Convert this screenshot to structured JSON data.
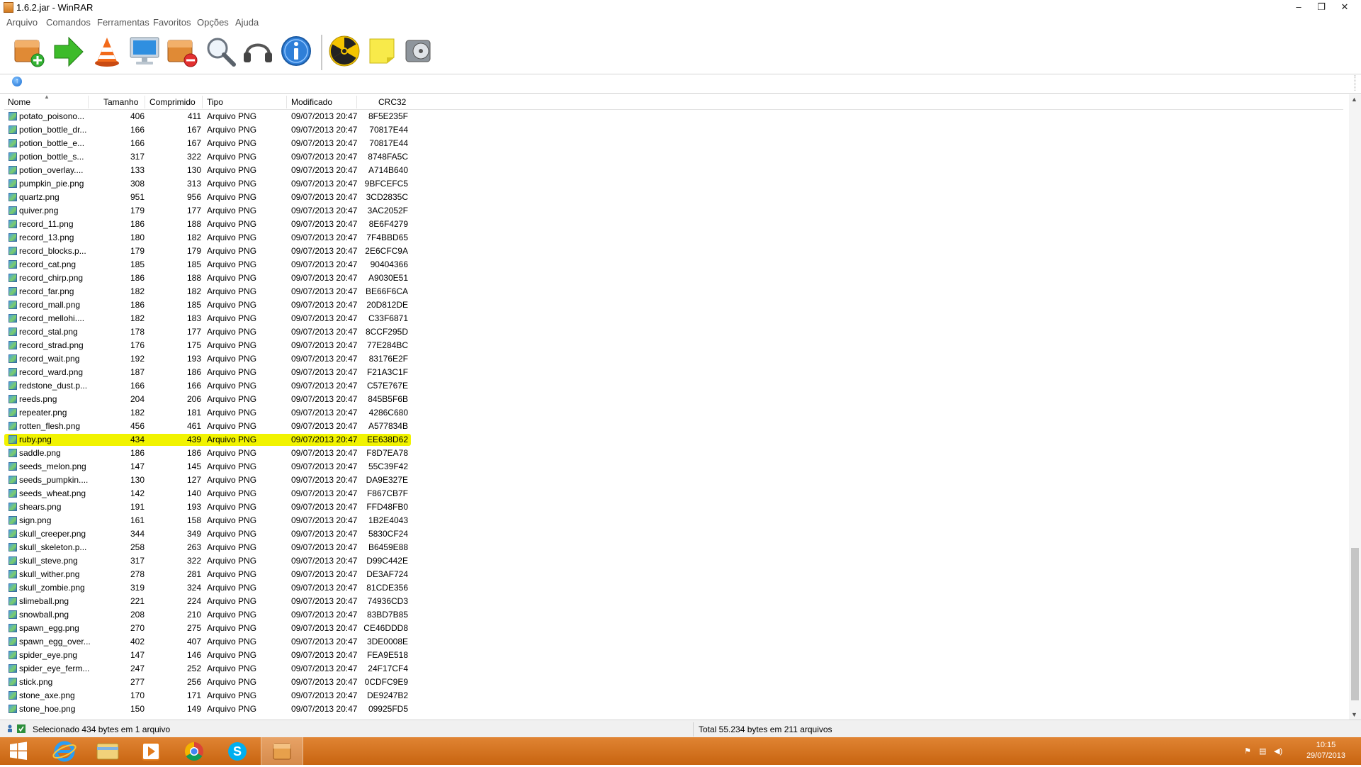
{
  "window": {
    "title": "1.6.2.jar - WinRAR",
    "controls": {
      "minimize": "–",
      "restore": "❐",
      "close": "✕"
    }
  },
  "menu": [
    "Arquivo",
    "Comandos",
    "Ferramentas",
    "Favoritos",
    "Opções",
    "Ajuda"
  ],
  "toolbar": {
    "buttons": [
      "add-icon",
      "extract-icon",
      "test-icon",
      "view-icon",
      "delete-icon",
      "find-icon",
      "wizard-icon",
      "info-icon",
      "virus-scan-icon",
      "comment-icon",
      "sfx-icon"
    ]
  },
  "columns": {
    "name": "Nome",
    "size": "Tamanho",
    "packed": "Comprimido",
    "type": "Tipo",
    "modified": "Modificado",
    "crc": "CRC32"
  },
  "files": [
    {
      "name": "potato_poisono...",
      "size": "406",
      "packed": "411",
      "type": "Arquivo PNG",
      "modified": "09/07/2013 20:47",
      "crc": "8F5E235F"
    },
    {
      "name": "potion_bottle_dr...",
      "size": "166",
      "packed": "167",
      "type": "Arquivo PNG",
      "modified": "09/07/2013 20:47",
      "crc": "70817E44"
    },
    {
      "name": "potion_bottle_e...",
      "size": "166",
      "packed": "167",
      "type": "Arquivo PNG",
      "modified": "09/07/2013 20:47",
      "crc": "70817E44"
    },
    {
      "name": "potion_bottle_s...",
      "size": "317",
      "packed": "322",
      "type": "Arquivo PNG",
      "modified": "09/07/2013 20:47",
      "crc": "8748FA5C"
    },
    {
      "name": "potion_overlay....",
      "size": "133",
      "packed": "130",
      "type": "Arquivo PNG",
      "modified": "09/07/2013 20:47",
      "crc": "A714B640"
    },
    {
      "name": "pumpkin_pie.png",
      "size": "308",
      "packed": "313",
      "type": "Arquivo PNG",
      "modified": "09/07/2013 20:47",
      "crc": "9BFCEFC5"
    },
    {
      "name": "quartz.png",
      "size": "951",
      "packed": "956",
      "type": "Arquivo PNG",
      "modified": "09/07/2013 20:47",
      "crc": "3CD2835C"
    },
    {
      "name": "quiver.png",
      "size": "179",
      "packed": "177",
      "type": "Arquivo PNG",
      "modified": "09/07/2013 20:47",
      "crc": "3AC2052F"
    },
    {
      "name": "record_11.png",
      "size": "186",
      "packed": "188",
      "type": "Arquivo PNG",
      "modified": "09/07/2013 20:47",
      "crc": "8E6F4279"
    },
    {
      "name": "record_13.png",
      "size": "180",
      "packed": "182",
      "type": "Arquivo PNG",
      "modified": "09/07/2013 20:47",
      "crc": "7F4BBD65"
    },
    {
      "name": "record_blocks.p...",
      "size": "179",
      "packed": "179",
      "type": "Arquivo PNG",
      "modified": "09/07/2013 20:47",
      "crc": "2E6CFC9A"
    },
    {
      "name": "record_cat.png",
      "size": "185",
      "packed": "185",
      "type": "Arquivo PNG",
      "modified": "09/07/2013 20:47",
      "crc": "90404366"
    },
    {
      "name": "record_chirp.png",
      "size": "186",
      "packed": "188",
      "type": "Arquivo PNG",
      "modified": "09/07/2013 20:47",
      "crc": "A9030E51"
    },
    {
      "name": "record_far.png",
      "size": "182",
      "packed": "182",
      "type": "Arquivo PNG",
      "modified": "09/07/2013 20:47",
      "crc": "BE66F6CA"
    },
    {
      "name": "record_mall.png",
      "size": "186",
      "packed": "185",
      "type": "Arquivo PNG",
      "modified": "09/07/2013 20:47",
      "crc": "20D812DE"
    },
    {
      "name": "record_mellohi....",
      "size": "182",
      "packed": "183",
      "type": "Arquivo PNG",
      "modified": "09/07/2013 20:47",
      "crc": "C33F6871"
    },
    {
      "name": "record_stal.png",
      "size": "178",
      "packed": "177",
      "type": "Arquivo PNG",
      "modified": "09/07/2013 20:47",
      "crc": "8CCF295D"
    },
    {
      "name": "record_strad.png",
      "size": "176",
      "packed": "175",
      "type": "Arquivo PNG",
      "modified": "09/07/2013 20:47",
      "crc": "77E284BC"
    },
    {
      "name": "record_wait.png",
      "size": "192",
      "packed": "193",
      "type": "Arquivo PNG",
      "modified": "09/07/2013 20:47",
      "crc": "83176E2F"
    },
    {
      "name": "record_ward.png",
      "size": "187",
      "packed": "186",
      "type": "Arquivo PNG",
      "modified": "09/07/2013 20:47",
      "crc": "F21A3C1F"
    },
    {
      "name": "redstone_dust.p...",
      "size": "166",
      "packed": "166",
      "type": "Arquivo PNG",
      "modified": "09/07/2013 20:47",
      "crc": "C57E767E"
    },
    {
      "name": "reeds.png",
      "size": "204",
      "packed": "206",
      "type": "Arquivo PNG",
      "modified": "09/07/2013 20:47",
      "crc": "845B5F6B"
    },
    {
      "name": "repeater.png",
      "size": "182",
      "packed": "181",
      "type": "Arquivo PNG",
      "modified": "09/07/2013 20:47",
      "crc": "4286C680"
    },
    {
      "name": "rotten_flesh.png",
      "size": "456",
      "packed": "461",
      "type": "Arquivo PNG",
      "modified": "09/07/2013 20:47",
      "crc": "A577834B"
    },
    {
      "name": "ruby.png",
      "size": "434",
      "packed": "439",
      "type": "Arquivo PNG",
      "modified": "09/07/2013 20:47",
      "crc": "EE638D62",
      "selected": true
    },
    {
      "name": "saddle.png",
      "size": "186",
      "packed": "186",
      "type": "Arquivo PNG",
      "modified": "09/07/2013 20:47",
      "crc": "F8D7EA78"
    },
    {
      "name": "seeds_melon.png",
      "size": "147",
      "packed": "145",
      "type": "Arquivo PNG",
      "modified": "09/07/2013 20:47",
      "crc": "55C39F42"
    },
    {
      "name": "seeds_pumpkin....",
      "size": "130",
      "packed": "127",
      "type": "Arquivo PNG",
      "modified": "09/07/2013 20:47",
      "crc": "DA9E327E"
    },
    {
      "name": "seeds_wheat.png",
      "size": "142",
      "packed": "140",
      "type": "Arquivo PNG",
      "modified": "09/07/2013 20:47",
      "crc": "F867CB7F"
    },
    {
      "name": "shears.png",
      "size": "191",
      "packed": "193",
      "type": "Arquivo PNG",
      "modified": "09/07/2013 20:47",
      "crc": "FFD48FB0"
    },
    {
      "name": "sign.png",
      "size": "161",
      "packed": "158",
      "type": "Arquivo PNG",
      "modified": "09/07/2013 20:47",
      "crc": "1B2E4043"
    },
    {
      "name": "skull_creeper.png",
      "size": "344",
      "packed": "349",
      "type": "Arquivo PNG",
      "modified": "09/07/2013 20:47",
      "crc": "5830CF24"
    },
    {
      "name": "skull_skeleton.p...",
      "size": "258",
      "packed": "263",
      "type": "Arquivo PNG",
      "modified": "09/07/2013 20:47",
      "crc": "B6459E88"
    },
    {
      "name": "skull_steve.png",
      "size": "317",
      "packed": "322",
      "type": "Arquivo PNG",
      "modified": "09/07/2013 20:47",
      "crc": "D99C442E"
    },
    {
      "name": "skull_wither.png",
      "size": "278",
      "packed": "281",
      "type": "Arquivo PNG",
      "modified": "09/07/2013 20:47",
      "crc": "DE3AF724"
    },
    {
      "name": "skull_zombie.png",
      "size": "319",
      "packed": "324",
      "type": "Arquivo PNG",
      "modified": "09/07/2013 20:47",
      "crc": "81CDE356"
    },
    {
      "name": "slimeball.png",
      "size": "221",
      "packed": "224",
      "type": "Arquivo PNG",
      "modified": "09/07/2013 20:47",
      "crc": "74936CD3"
    },
    {
      "name": "snowball.png",
      "size": "208",
      "packed": "210",
      "type": "Arquivo PNG",
      "modified": "09/07/2013 20:47",
      "crc": "83BD7B85"
    },
    {
      "name": "spawn_egg.png",
      "size": "270",
      "packed": "275",
      "type": "Arquivo PNG",
      "modified": "09/07/2013 20:47",
      "crc": "CE46DDD8"
    },
    {
      "name": "spawn_egg_over...",
      "size": "402",
      "packed": "407",
      "type": "Arquivo PNG",
      "modified": "09/07/2013 20:47",
      "crc": "3DE0008E"
    },
    {
      "name": "spider_eye.png",
      "size": "147",
      "packed": "146",
      "type": "Arquivo PNG",
      "modified": "09/07/2013 20:47",
      "crc": "FEA9E518"
    },
    {
      "name": "spider_eye_ferm...",
      "size": "247",
      "packed": "252",
      "type": "Arquivo PNG",
      "modified": "09/07/2013 20:47",
      "crc": "24F17CF4"
    },
    {
      "name": "stick.png",
      "size": "277",
      "packed": "256",
      "type": "Arquivo PNG",
      "modified": "09/07/2013 20:47",
      "crc": "0CDFC9E9"
    },
    {
      "name": "stone_axe.png",
      "size": "170",
      "packed": "171",
      "type": "Arquivo PNG",
      "modified": "09/07/2013 20:47",
      "crc": "DE9247B2"
    },
    {
      "name": "stone_hoe.png",
      "size": "150",
      "packed": "149",
      "type": "Arquivo PNG",
      "modified": "09/07/2013 20:47",
      "crc": "09925FD5"
    }
  ],
  "status": {
    "left": "Selecionado 434 bytes em 1 arquivo",
    "right": "Total 55.234 bytes em 211 arquivos"
  },
  "taskbar": {
    "apps": [
      "windows-start-icon",
      "internet-explorer-icon",
      "file-explorer-icon",
      "media-player-icon",
      "chrome-icon",
      "skype-icon",
      "winrar-icon"
    ],
    "time": "10:15",
    "date": "29/07/2013"
  },
  "colors": {
    "highlight": "#f1f300",
    "taskbar": "#d8771a"
  }
}
